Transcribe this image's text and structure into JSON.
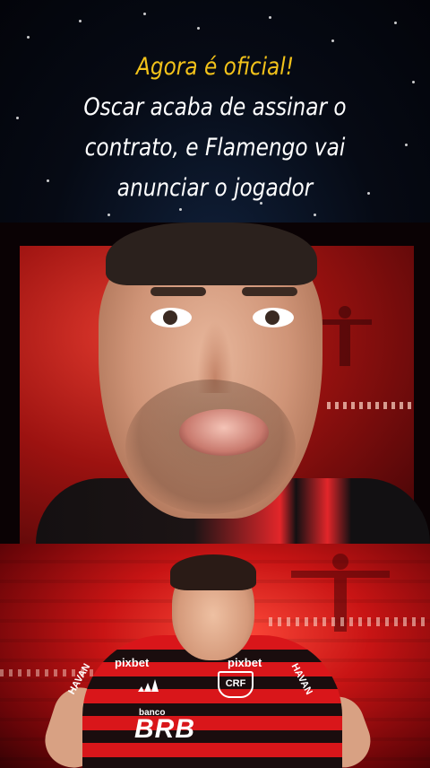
{
  "caption": {
    "highlight": "Agora é oficial!",
    "line1": "Oscar acaba de assinar o",
    "line2": "contrato, e Flamengo vai",
    "line3": "anunciar o jogador"
  },
  "poster": {
    "sponsor_chest_left": "pixbet",
    "sponsor_chest_right": "pixbet",
    "sleeve_left": "HAVAN",
    "sleeve_right": "HAVAN",
    "crest": "CRF",
    "banco": "banco",
    "brb": "BRB"
  },
  "colors": {
    "highlight": "#f2c21a",
    "caption_text": "#ffffff",
    "flamengo_red": "#d9161a",
    "flamengo_black": "#1a0d0e"
  }
}
